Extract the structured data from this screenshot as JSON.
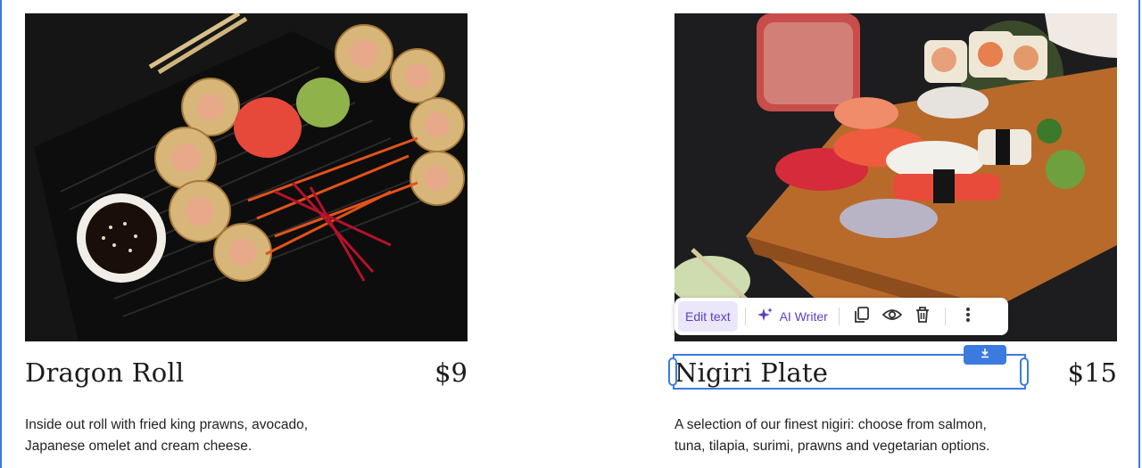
{
  "items": [
    {
      "name": "Dragon Roll",
      "price": "$9",
      "description_line1": "Inside out roll with fried king prawns, avocado,",
      "description_line2": "Japanese omelet and cream cheese."
    },
    {
      "name": "Nigiri Plate",
      "price": "$15",
      "description_line1": "A selection of our finest nigiri: choose from salmon,",
      "description_line2": "tuna, tilapia, surimi, prawns and vegetarian options."
    }
  ],
  "toolbar": {
    "edit_text_label": "Edit text",
    "ai_writer_label": "AI Writer",
    "icons": [
      "sparkle-icon",
      "duplicate-icon",
      "eye-icon",
      "trash-icon",
      "more-vertical-icon"
    ]
  },
  "selection": {
    "download_icon": "download-icon"
  },
  "colors": {
    "accent": "#3b7be0",
    "toolbar_purple": "#5a3fc0",
    "toolbar_purple_bg": "#ece6fb"
  }
}
